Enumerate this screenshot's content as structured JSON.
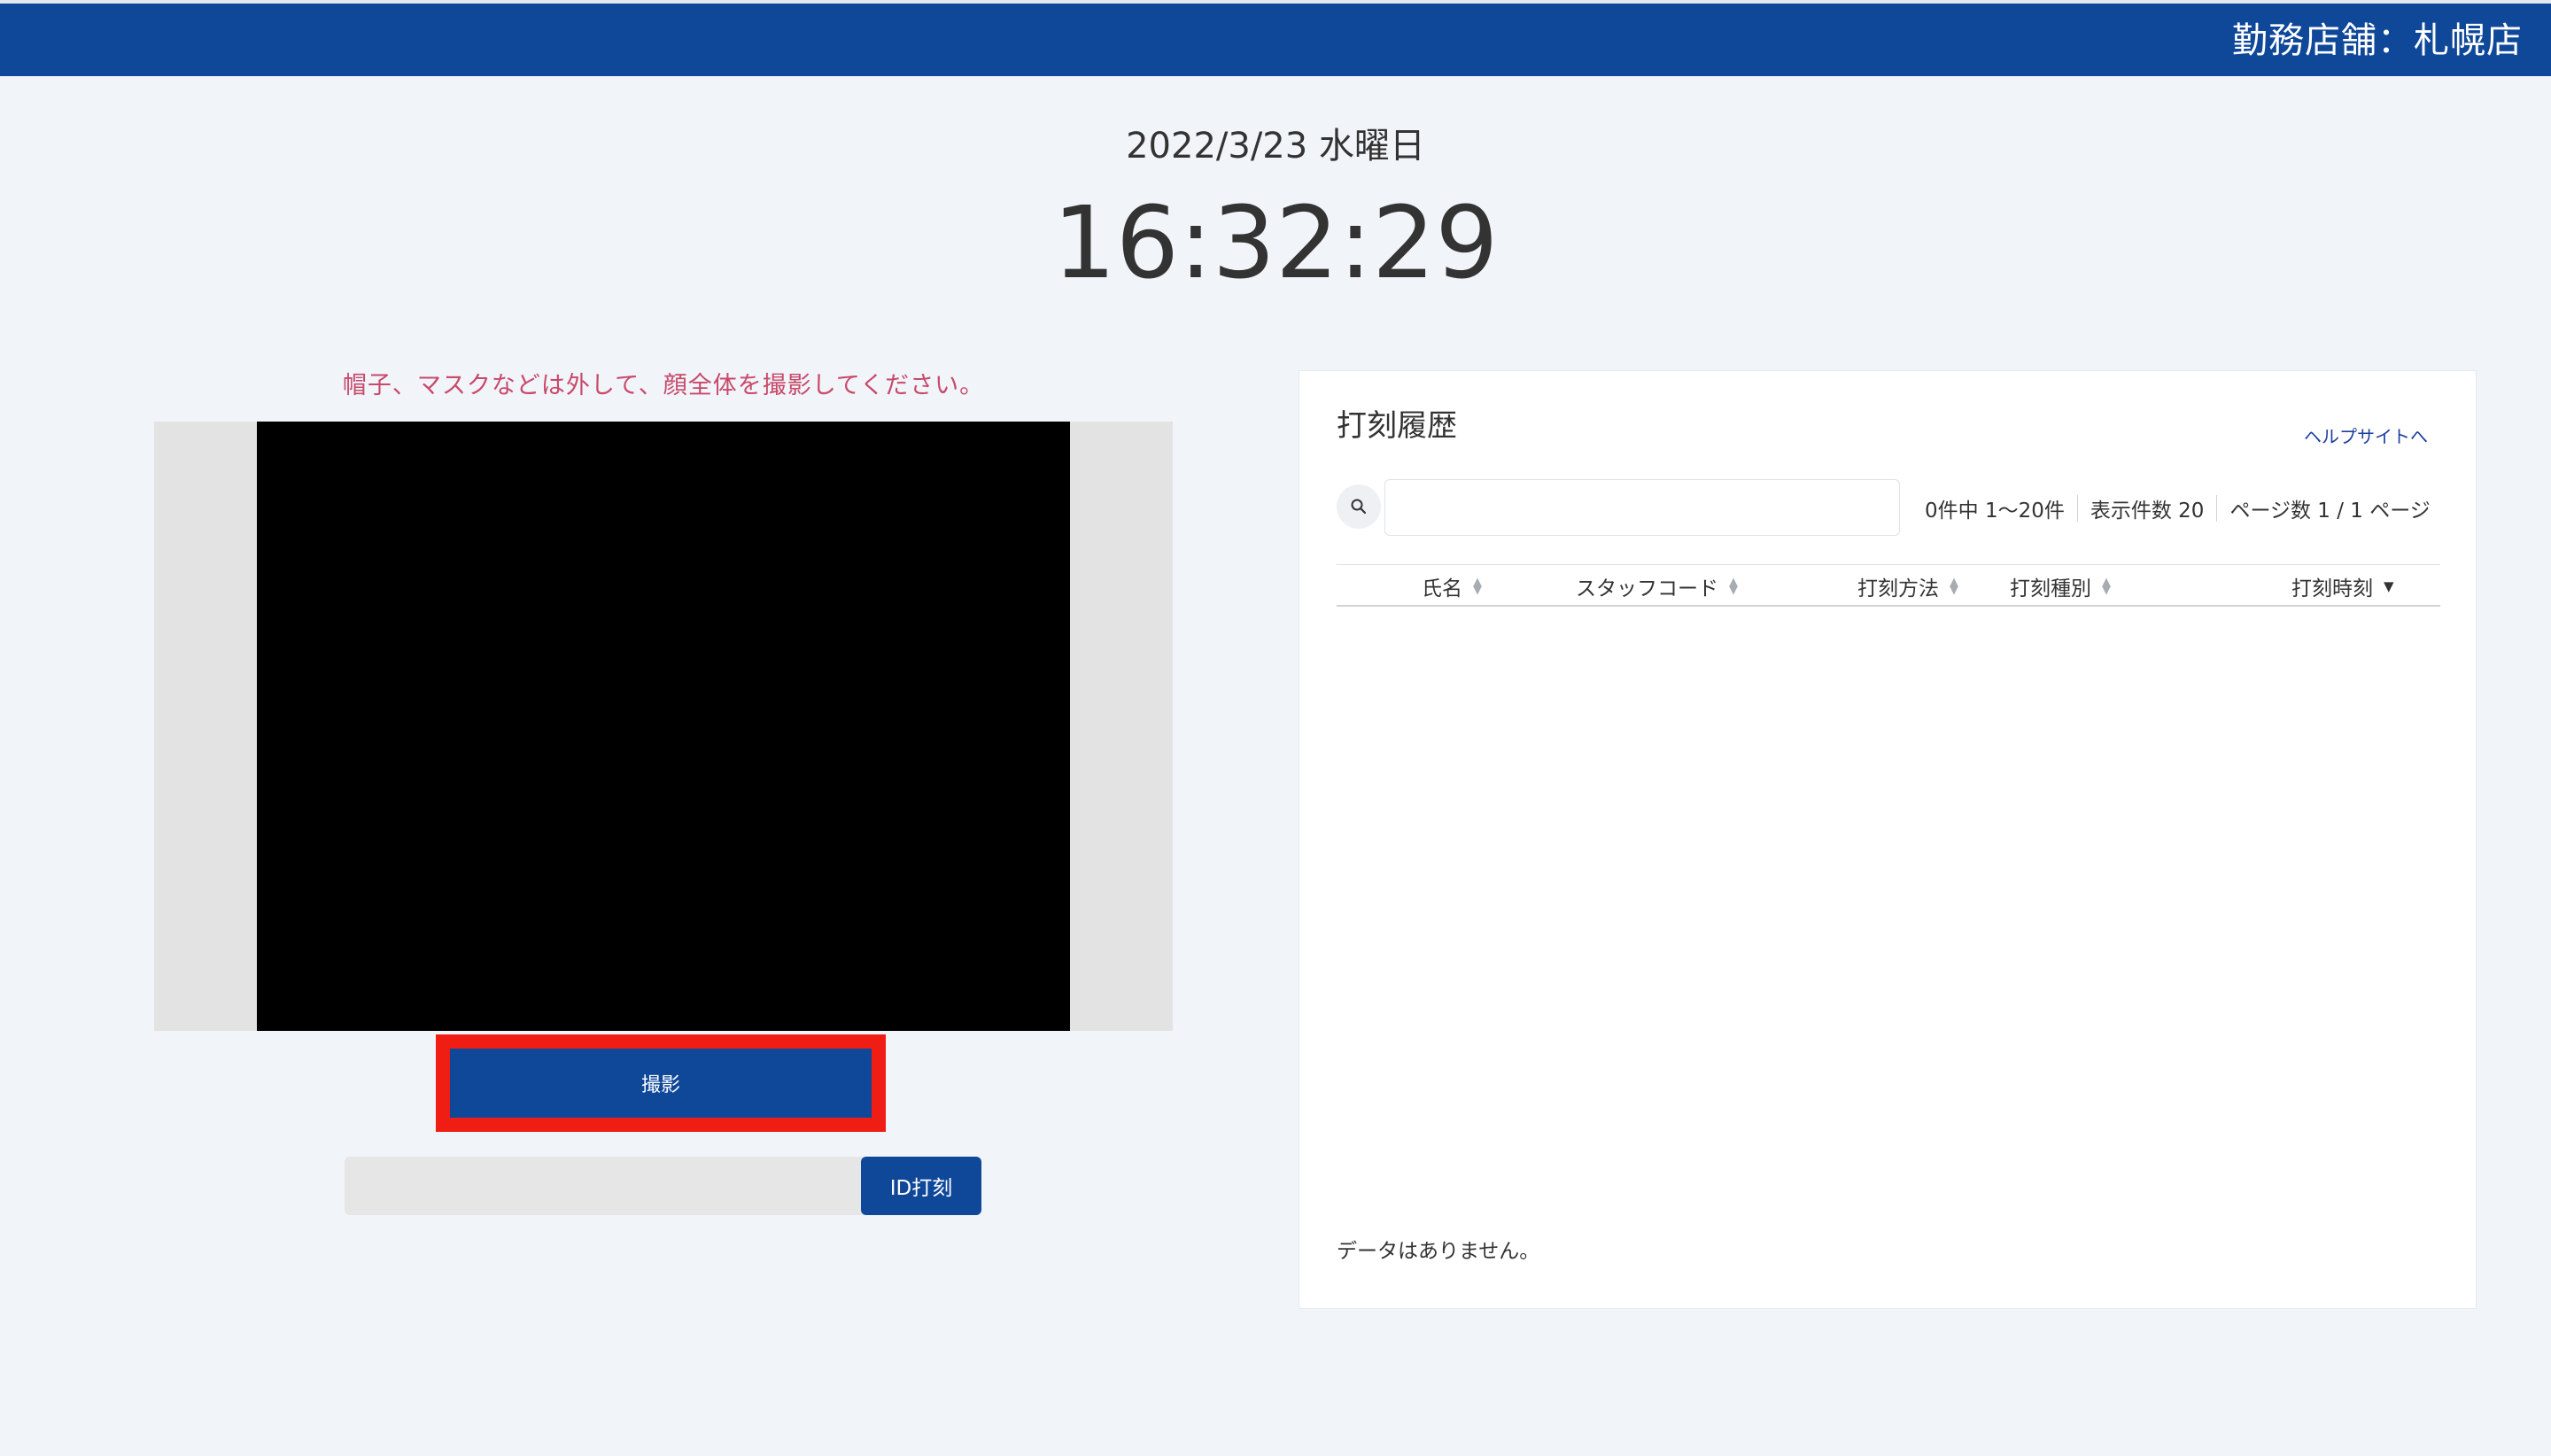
{
  "header": {
    "store_label": "勤務店舗：札幌店"
  },
  "datetime": {
    "date": "2022/3/23 水曜日",
    "time": "16:32:29"
  },
  "camera": {
    "notice": "帽子、マスクなどは外して、顔全体を撮影してください。",
    "shoot_button": "撮影"
  },
  "id_punch": {
    "input_value": "",
    "button_label": "ID打刻"
  },
  "history": {
    "title": "打刻履歴",
    "help_link": "ヘルプサイトへ",
    "search_value": "",
    "result_count": "0件中 1〜20件",
    "per_page": "表示件数 20",
    "page_info": "ページ数 1 / 1 ページ",
    "columns": [
      {
        "label": "氏名",
        "sort": "none"
      },
      {
        "label": "スタッフコード",
        "sort": "none"
      },
      {
        "label": "打刻方法",
        "sort": "none"
      },
      {
        "label": "打刻種別",
        "sort": "none"
      },
      {
        "label": "打刻時刻",
        "sort": "desc"
      }
    ],
    "empty_message": "データはありません。"
  },
  "colors": {
    "brand_blue": "#0f4799",
    "notice_pink": "#c8496a",
    "highlight_red": "#ef1d14"
  }
}
